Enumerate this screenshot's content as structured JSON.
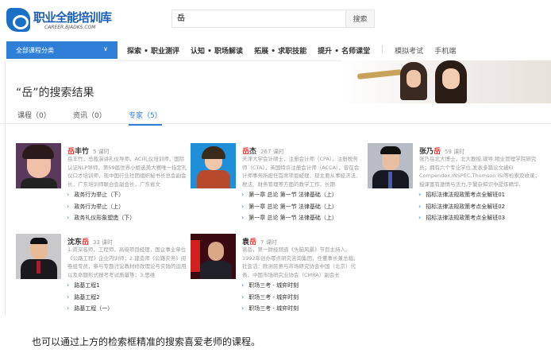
{
  "logo": {
    "title": "职业全能培训库",
    "subtitle": "CAREER.BJADKS.COM"
  },
  "search": {
    "value": "岳",
    "button": "搜索"
  },
  "category": {
    "label": "全部课程分类",
    "chevron": "chevron-down-icon"
  },
  "nav": [
    {
      "label": "探索 • 职业测评",
      "bold": true
    },
    {
      "label": "认知 • 职场解读",
      "bold": true
    },
    {
      "label": "拓展 • 求职技能",
      "bold": true
    },
    {
      "label": "提升 • 名师课堂",
      "bold": true
    },
    {
      "label": "模拟考试",
      "bold": false
    },
    {
      "label": "手机端",
      "bold": false
    }
  ],
  "results_title": "“岳”的搜索结果",
  "tabs": [
    {
      "label": "课程（0）"
    },
    {
      "label": "资讯（0）"
    },
    {
      "label": "专家（5）",
      "active": true
    }
  ],
  "experts": [
    {
      "name_pre": "",
      "name_hl": "岳",
      "name_post": "丰竹",
      "hours": "5 课时",
      "desc": "岳丰竹，总裁演讲礼仪导师，ACI礼仪培训师，国际认证NLP导师，第59届世界小姐选美大赛唯一指定礼仪口才培训师，现中国行业社团组织秘书长总会副会长，广东培训师联合会副会长，广东省文",
      "courses": [
        "政务行为举止（下）",
        "政务行为举止（上）",
        "政务礼仪形象塑造（下）"
      ]
    },
    {
      "name_pre": "",
      "name_hl": "岳",
      "name_post": "杰",
      "hours": "267 课时",
      "desc": "天津大学会计硕士，注册会计师（CPA），注册税务师（CTA），英国特许注册会计师（ACCA），曾在会计师事务所担任首席项目经理，现主要从事经济法、税法、财务管理等方面的教学工作，长期",
      "courses": [
        "第一章 总论 第一节 法律基础（上）",
        "第一章 总论 第一节 法律基础（上）",
        "第一章 总论 第一节 法律基础（上）"
      ]
    },
    {
      "name_pre": "张乃",
      "name_hl": "岳",
      "name_post": "",
      "hours": "59 课时",
      "desc": "张乃岳北大博士，北大教授,硕导,物业管理学院研究员；拥有六个专业学位,发表多篇论文被EI Compendex,INSPEC,Thomson ISI等检索及收录；授课富有激情与活力,于繁杂知识中提炼精华,",
      "courses": [
        "招标法律法规政策考点全解班01",
        "招标法律法规政策考点全解班02",
        "招标法律法规政策考点全解班03"
      ]
    },
    {
      "name_pre": "沈东",
      "name_hl": "岳",
      "name_post": "",
      "hours": "33 课时",
      "desc": "1.资深名师，工程师，高级项目经理，国企事业单位《公路工程》企业内训师；2.建造师《公路实务》阅卷组专员，参与专题讨论教材修改理论与实践的运用以及命题形式报考考试质量等；3.思维",
      "courses": [
        "路基工程1",
        "路基工程2",
        "路基工程（一）"
      ]
    },
    {
      "name_pre": "袁",
      "name_hl": "岳",
      "name_post": "",
      "hours": "7 课时",
      "desc": "袁岳，第一财经频道《头脑风暴》节目主持人。1992年创办零点研究咨询集团，任董事长兼总裁。社会活：欧洲民意与市场研究协会中国（北京）代表、中国市场研究业协会（CMRA）副会长",
      "courses": [
        "职场三考 - 城弈时刻",
        "职场三考 - 城弈时刻",
        "职场三考 - 城弈时刻"
      ]
    }
  ],
  "caption": "也可以通过上方的检索框精准的搜索喜爱老师的课程。"
}
